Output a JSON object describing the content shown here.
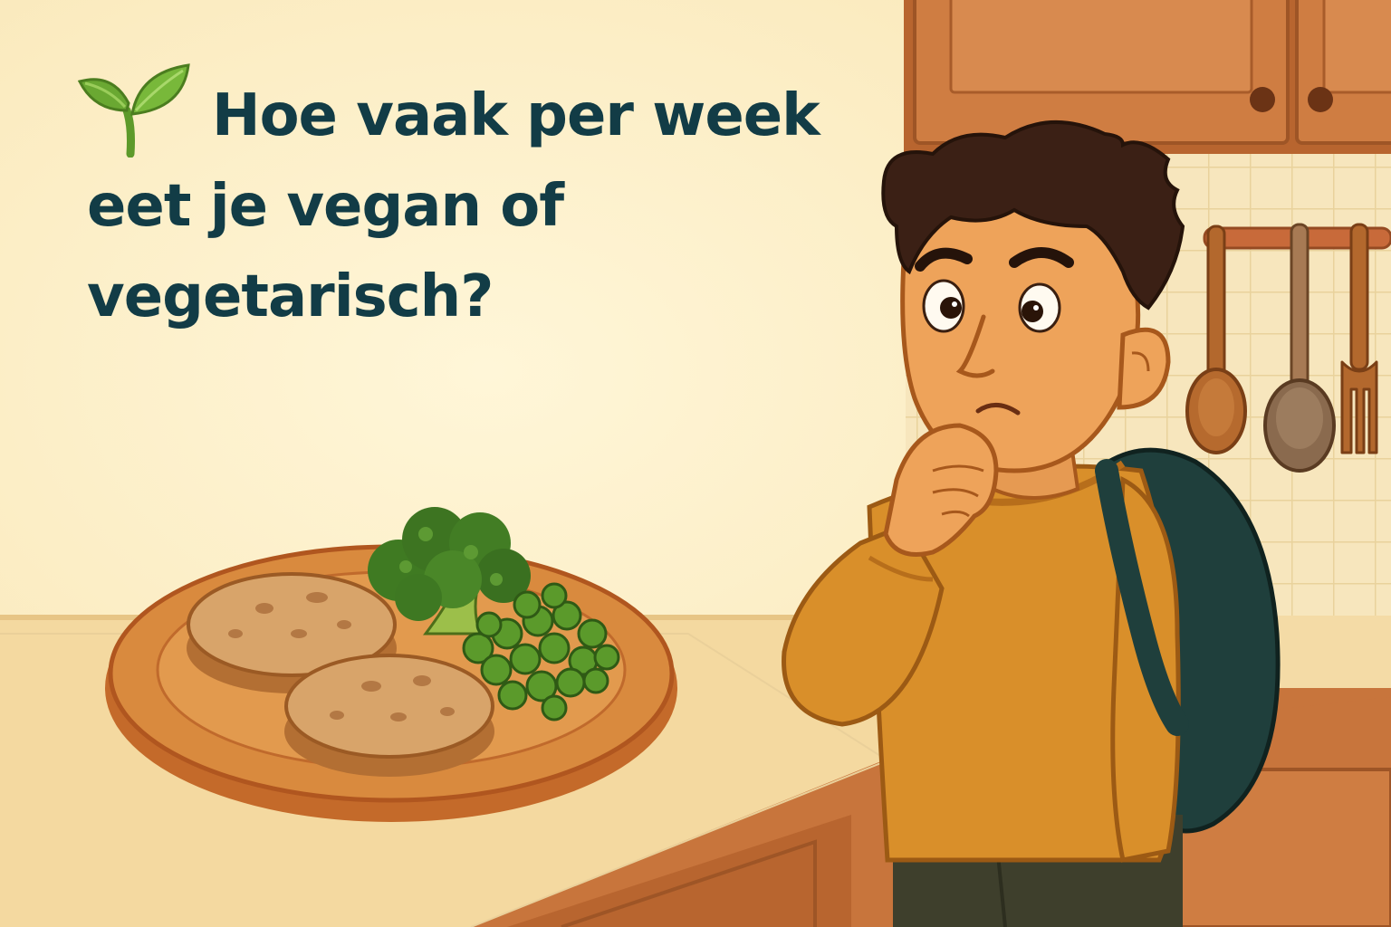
{
  "headline": {
    "lines": [
      "Hoe vaak per week",
      "eet je vegan of",
      "vegetarisch?"
    ]
  },
  "icons": {
    "leading": "leaf-icon"
  },
  "colors": {
    "headline": "#123c46",
    "wall": "#fbeec0",
    "sweater": "#d98f2a",
    "backpack": "#1f3f3c",
    "cabinet": "#c8753c",
    "broccoli": "#3f7a22",
    "peas": "#4e8f24",
    "leaf": "#6aa832"
  }
}
